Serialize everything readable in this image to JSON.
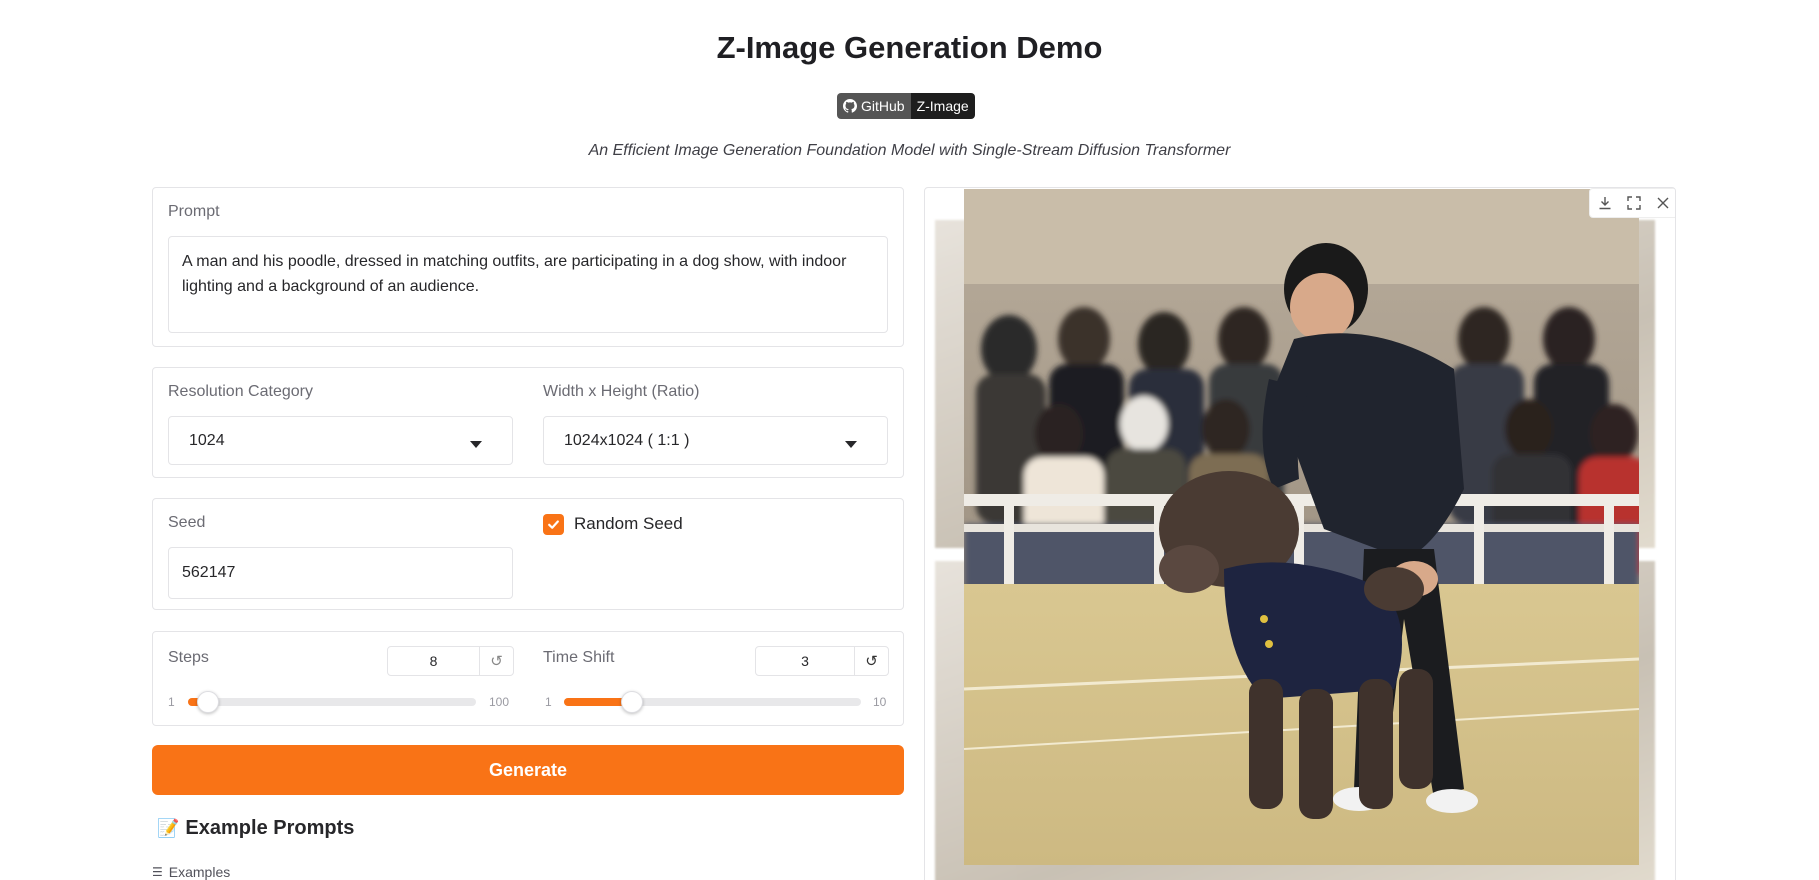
{
  "header": {
    "title": "Z-Image Generation Demo",
    "badge_left": "GitHub",
    "badge_right": "Z-Image",
    "subtitle": "An Efficient Image Generation Foundation Model with Single-Stream Diffusion Transformer"
  },
  "prompt": {
    "label": "Prompt",
    "value": "A man and his poodle, dressed in matching outfits, are participating in a dog show, with indoor lighting and a background of an audience."
  },
  "resolution": {
    "category_label": "Resolution Category",
    "category_value": "1024",
    "size_label": "Width x Height (Ratio)",
    "size_value": "1024x1024 ( 1:1 )"
  },
  "seed": {
    "label": "Seed",
    "value": "562147",
    "random_label": "Random Seed",
    "random_checked": true
  },
  "steps": {
    "label": "Steps",
    "value": "8",
    "min": "1",
    "max": "100",
    "fraction": 0.07
  },
  "time_shift": {
    "label": "Time Shift",
    "value": "3",
    "min": "1",
    "max": "10",
    "fraction": 0.23
  },
  "actions": {
    "generate_label": "Generate"
  },
  "examples": {
    "heading": "Example Prompts",
    "heading_icon": "memo-icon",
    "list_label": "Examples"
  },
  "gallery": {
    "toolbar_icons": [
      "download-icon",
      "fullscreen-icon",
      "close-icon"
    ]
  },
  "colors": {
    "accent": "#f97316",
    "border": "#e4e4e7"
  }
}
